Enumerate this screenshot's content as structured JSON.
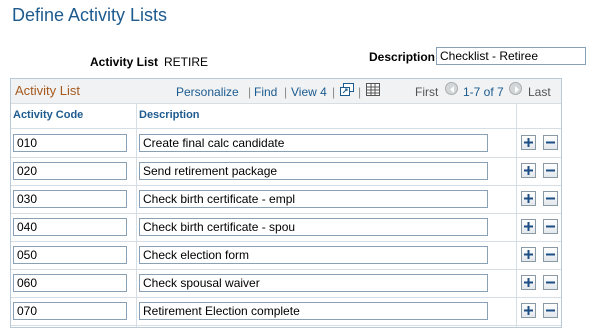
{
  "page": {
    "title": "Define Activity Lists"
  },
  "header": {
    "activity_list_label": "Activity List",
    "activity_list_value": "RETIRE",
    "description_label": "Description",
    "description_value": "Checklist - Retiree"
  },
  "grid": {
    "title": "Activity List",
    "personalize": "Personalize",
    "find": "Find",
    "view": "View 4",
    "first": "First",
    "range": "1-7 of 7",
    "last": "Last",
    "columns": {
      "code": "Activity Code",
      "description": "Description"
    },
    "rows": [
      {
        "code": "010",
        "description": "Create final calc candidate"
      },
      {
        "code": "020",
        "description": "Send retirement package"
      },
      {
        "code": "030",
        "description": "Check birth certificate - empl"
      },
      {
        "code": "040",
        "description": "Check birth certificate - spou"
      },
      {
        "code": "050",
        "description": "Check election form"
      },
      {
        "code": "060",
        "description": "Check spousal waiver"
      },
      {
        "code": "070",
        "description": "Retirement Election complete"
      }
    ]
  },
  "icons": {
    "zoom": "view-all-icon",
    "download": "download-grid-icon",
    "prev": "previous-arrow-icon",
    "next": "next-arrow-icon",
    "add": "add-row-icon",
    "delete": "delete-row-icon"
  }
}
